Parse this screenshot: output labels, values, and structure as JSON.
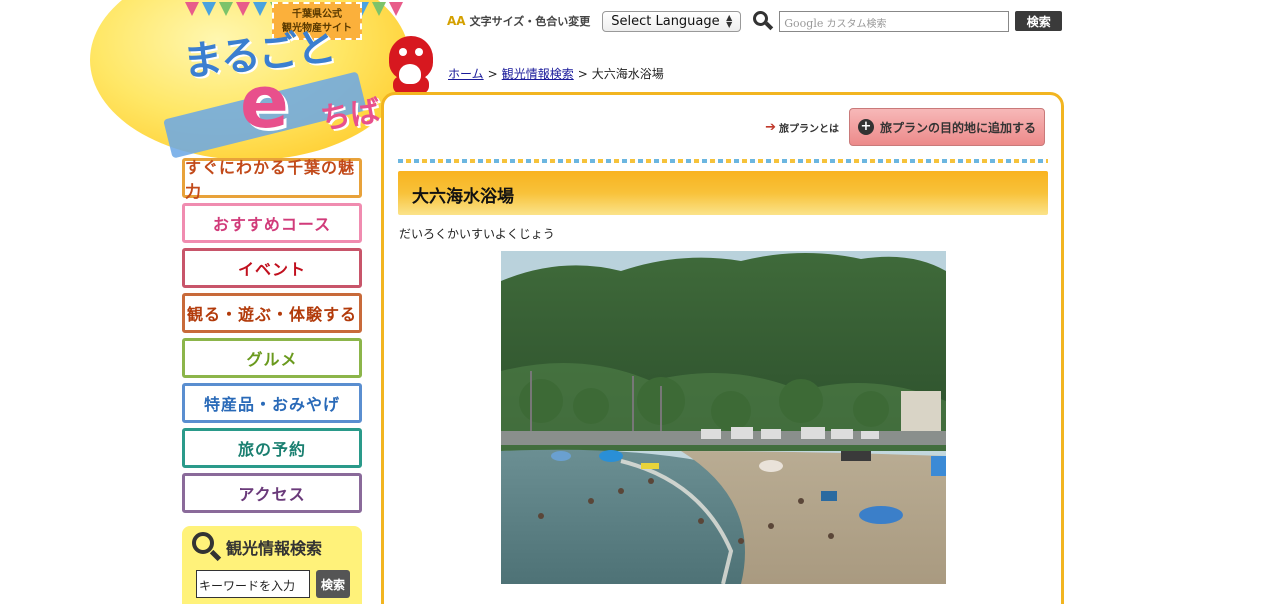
{
  "logo": {
    "badge_line1": "千葉県公式",
    "badge_line2": "観光物産サイト",
    "text_main": "まるごと",
    "text_e": "e",
    "text_chiba": "ちば"
  },
  "header": {
    "font_color_label": "文字サイズ・色合い変更",
    "font_color_icon": "AA",
    "language_select": "Select Language",
    "search_placeholder": "カスタム検索",
    "search_google": "Google",
    "search_button": "検索"
  },
  "breadcrumb": {
    "home": "ホーム",
    "sep1": ">",
    "category": "観光情報検索",
    "sep2": ">",
    "current": "大六海水浴場"
  },
  "sidenav": {
    "items": [
      {
        "label": "すぐにわかる千葉の魅力"
      },
      {
        "label": "おすすめコース"
      },
      {
        "label": "イベント"
      },
      {
        "label": "観る・遊ぶ・体験する"
      },
      {
        "label": "グルメ"
      },
      {
        "label": "特産品・おみやげ"
      },
      {
        "label": "旅の予約"
      },
      {
        "label": "アクセス"
      }
    ]
  },
  "side_search": {
    "title": "観光情報検索",
    "input_value": "キーワードを入力",
    "button": "検索"
  },
  "main": {
    "plan_link": "旅プランとは",
    "plan_button": "旅プランの目的地に追加する",
    "plan_plus": "+",
    "title": "大六海水浴場",
    "reading": "だいろくかいすいよくじょう"
  },
  "colors": {
    "accent_orange": "#f2b520",
    "title_gradient_top": "#f9b320",
    "plan_button_pink": "#ec8a8a",
    "link_blue": "#1a1a9a"
  }
}
